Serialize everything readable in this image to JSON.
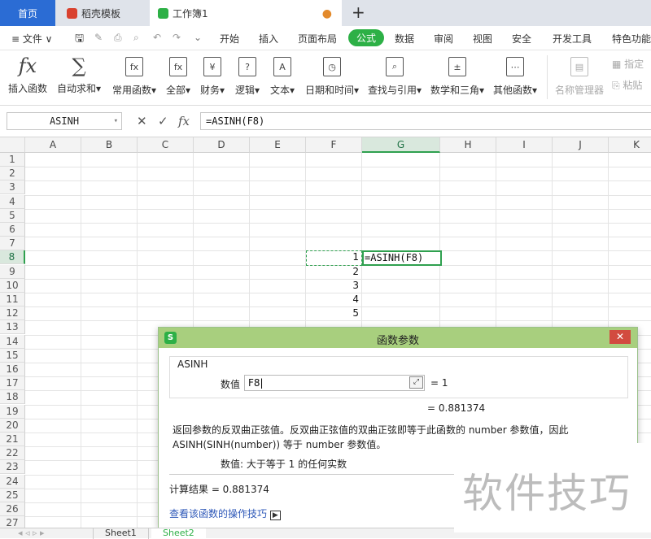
{
  "tabs": {
    "home": "首页",
    "template": "稻壳模板",
    "workbook": "工作簿1",
    "add": "+"
  },
  "menubar": {
    "file": "≡ 文件 ∨",
    "items": [
      "开始",
      "插入",
      "页面布局",
      "公式",
      "数据",
      "审阅",
      "视图",
      "安全",
      "开发工具",
      "特色功能"
    ],
    "active": "公式"
  },
  "ribbon": {
    "buttons": [
      {
        "label": "插入函数",
        "icon": "fx"
      },
      {
        "label": "自动求和▾",
        "icon": "∑"
      },
      {
        "label": "常用函数▾",
        "icon": "fx"
      },
      {
        "label": "全部▾",
        "icon": "fx"
      },
      {
        "label": "财务▾",
        "icon": "¥"
      },
      {
        "label": "逻辑▾",
        "icon": "?"
      },
      {
        "label": "文本▾",
        "icon": "A"
      },
      {
        "label": "日期和时间▾",
        "icon": "◷"
      },
      {
        "label": "查找与引用▾",
        "icon": "⌕"
      },
      {
        "label": "数学和三角▾",
        "icon": "±"
      },
      {
        "label": "其他函数▾",
        "icon": "⋯"
      }
    ],
    "name_manager": "名称管理器",
    "specify": "指定",
    "paste": "粘贴"
  },
  "formula_bar": {
    "name_box": "ASINH",
    "cancel": "✕",
    "confirm": "✓",
    "fx": "fx",
    "formula": "=ASINH(F8)"
  },
  "grid": {
    "columns": [
      "A",
      "B",
      "C",
      "D",
      "E",
      "F",
      "G",
      "H",
      "I",
      "J",
      "K"
    ],
    "selected_column": "G",
    "rows": [
      "1",
      "2",
      "3",
      "4",
      "5",
      "6",
      "7",
      "8",
      "9",
      "10",
      "11",
      "12",
      "13",
      "14",
      "15",
      "16",
      "17",
      "18",
      "19",
      "20",
      "21",
      "22",
      "23",
      "24",
      "25",
      "26",
      "27"
    ],
    "selected_row": "8",
    "f_values": [
      "1",
      "2",
      "3",
      "4",
      "5"
    ],
    "g8_formula": "=ASINH(F8)"
  },
  "dialog": {
    "title": "函数参数",
    "function_name": "ASINH",
    "arg_label": "数值",
    "arg_value": "F8",
    "arg_result": "= 1",
    "fn_result": "= 0.881374",
    "description": "返回参数的反双曲正弦值。反双曲正弦值的双曲正弦即等于此函数的 number 参数值，因此 ASINH(SINH(number)) 等于 number 参数值。",
    "param_help": "数值:  大于等于 1 的任何实数",
    "calc_result": "计算结果 = 0.881374",
    "help_link": "查看该函数的操作技巧"
  },
  "sheets": [
    "Sheet1",
    "Sheet2"
  ],
  "watermark": "软件技巧",
  "colors": {
    "accent_green": "#2db046",
    "home_tab_blue": "#2b6cd4",
    "dialog_title": "#a8cf7e",
    "close_red": "#d24b3f"
  }
}
